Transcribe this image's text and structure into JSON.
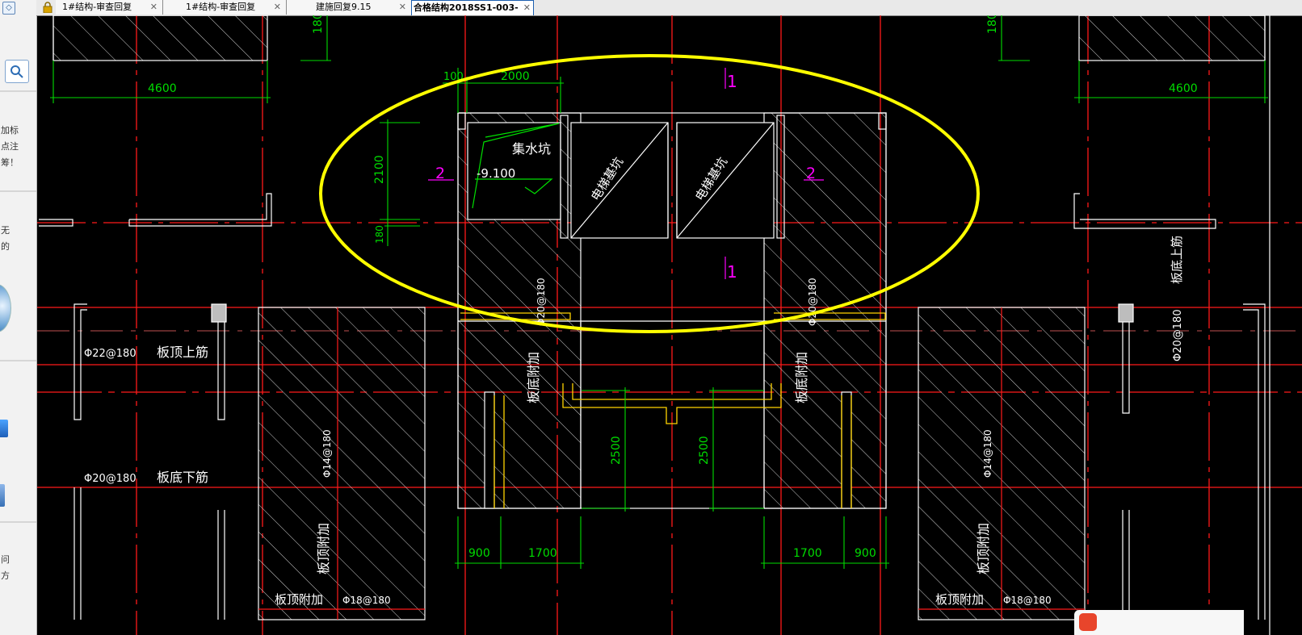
{
  "tabs": [
    {
      "label": "1#结构-审查回复",
      "active": false
    },
    {
      "label": "1#结构-审查回复",
      "active": false
    },
    {
      "label": "建施回复9.15",
      "active": false
    },
    {
      "label": "合格结构2018SS1-003-",
      "active": true
    }
  ],
  "left_panel": {
    "collapse_glyph": "◇",
    "text_lines": [
      "加标",
      "点注",
      "筹！",
      "无",
      "的",
      "问",
      "方"
    ]
  },
  "drawing": {
    "dimensions": {
      "top_left_width": "4600",
      "top_right_width": "4600",
      "top_left_height": "180",
      "top_right_height": "180",
      "pit_offset": "100",
      "pit_width": "2000",
      "pit_height": "2100",
      "pit_wall": "180",
      "left_gap": "2500",
      "right_gap": "2500",
      "bottom_left_a": "900",
      "bottom_left_b": "1700",
      "bottom_right_a": "1700",
      "bottom_right_b": "900"
    },
    "section_marks": {
      "mark_1": "1",
      "mark_2": "2"
    },
    "labels": {
      "sump_pit": "集水坑",
      "sump_elevation": "-9.100",
      "elevator_pit_1": "电梯基坑",
      "elevator_pit_2": "电梯基坑",
      "slab_top_bar": "板顶上筋",
      "slab_bottom_bar": "板底下筋",
      "slab_bottom_bar_right": "板底上筋",
      "slab_top_additional": "板顶附加",
      "slab_bottom_additional": "板底附加",
      "rebar_22_180": "Φ22@180",
      "rebar_20_180": "Φ20@180",
      "rebar_14_180": "Φ14@180",
      "rebar_18_180": "Φ18@180"
    }
  },
  "colors": {
    "background": "#000000",
    "structure_lines": "#ffffff",
    "axis_lines": "#ff0000",
    "dimension_lines": "#00ff00",
    "section_marks": "#ff00ff",
    "highlight_ellipse": "#ffff00",
    "wall_edge": "#ffff00"
  },
  "icons": {
    "lock": "lock-icon",
    "close": "close-icon",
    "search": "search-icon"
  }
}
